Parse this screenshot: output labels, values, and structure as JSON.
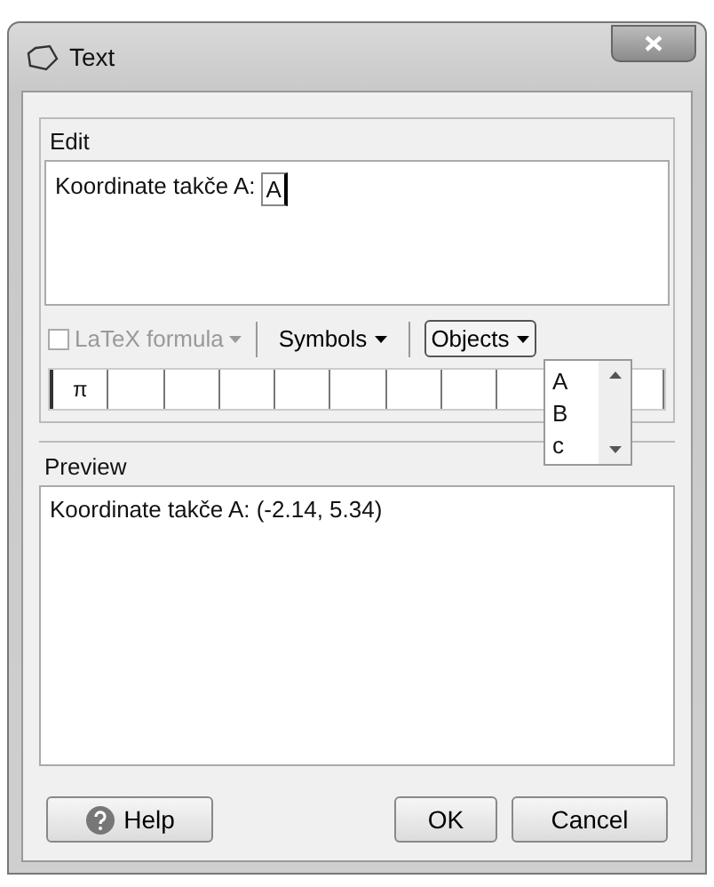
{
  "window": {
    "title": "Text"
  },
  "edit": {
    "label": "Edit",
    "text": "Koordinate takče A:",
    "token": "A"
  },
  "toolbar": {
    "latex": {
      "label": "LaTeX formula",
      "checked": false,
      "disabled": true
    },
    "symbols": {
      "label": "Symbols",
      "expanded": false
    },
    "objects": {
      "label": "Objects",
      "expanded": true
    }
  },
  "symbol_row": [
    "π"
  ],
  "objects_list": [
    {
      "label": "A",
      "selected": false
    },
    {
      "label": "B",
      "selected": false
    },
    {
      "label": "c",
      "selected": false
    }
  ],
  "preview": {
    "label": "Preview",
    "text": "Koordinate takče A: (-2.14, 5.34)"
  },
  "buttons": {
    "help": "Help",
    "ok": "OK",
    "cancel": "Cancel"
  }
}
